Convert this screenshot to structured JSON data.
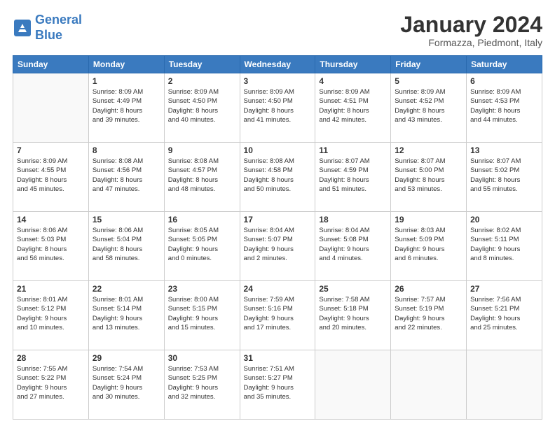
{
  "header": {
    "logo_line1": "General",
    "logo_line2": "Blue",
    "title": "January 2024",
    "subtitle": "Formazza, Piedmont, Italy"
  },
  "days_of_week": [
    "Sunday",
    "Monday",
    "Tuesday",
    "Wednesday",
    "Thursday",
    "Friday",
    "Saturday"
  ],
  "weeks": [
    [
      {
        "day": "",
        "info": ""
      },
      {
        "day": "1",
        "info": "Sunrise: 8:09 AM\nSunset: 4:49 PM\nDaylight: 8 hours\nand 39 minutes."
      },
      {
        "day": "2",
        "info": "Sunrise: 8:09 AM\nSunset: 4:50 PM\nDaylight: 8 hours\nand 40 minutes."
      },
      {
        "day": "3",
        "info": "Sunrise: 8:09 AM\nSunset: 4:50 PM\nDaylight: 8 hours\nand 41 minutes."
      },
      {
        "day": "4",
        "info": "Sunrise: 8:09 AM\nSunset: 4:51 PM\nDaylight: 8 hours\nand 42 minutes."
      },
      {
        "day": "5",
        "info": "Sunrise: 8:09 AM\nSunset: 4:52 PM\nDaylight: 8 hours\nand 43 minutes."
      },
      {
        "day": "6",
        "info": "Sunrise: 8:09 AM\nSunset: 4:53 PM\nDaylight: 8 hours\nand 44 minutes."
      }
    ],
    [
      {
        "day": "7",
        "info": "Sunrise: 8:09 AM\nSunset: 4:55 PM\nDaylight: 8 hours\nand 45 minutes."
      },
      {
        "day": "8",
        "info": "Sunrise: 8:08 AM\nSunset: 4:56 PM\nDaylight: 8 hours\nand 47 minutes."
      },
      {
        "day": "9",
        "info": "Sunrise: 8:08 AM\nSunset: 4:57 PM\nDaylight: 8 hours\nand 48 minutes."
      },
      {
        "day": "10",
        "info": "Sunrise: 8:08 AM\nSunset: 4:58 PM\nDaylight: 8 hours\nand 50 minutes."
      },
      {
        "day": "11",
        "info": "Sunrise: 8:07 AM\nSunset: 4:59 PM\nDaylight: 8 hours\nand 51 minutes."
      },
      {
        "day": "12",
        "info": "Sunrise: 8:07 AM\nSunset: 5:00 PM\nDaylight: 8 hours\nand 53 minutes."
      },
      {
        "day": "13",
        "info": "Sunrise: 8:07 AM\nSunset: 5:02 PM\nDaylight: 8 hours\nand 55 minutes."
      }
    ],
    [
      {
        "day": "14",
        "info": "Sunrise: 8:06 AM\nSunset: 5:03 PM\nDaylight: 8 hours\nand 56 minutes."
      },
      {
        "day": "15",
        "info": "Sunrise: 8:06 AM\nSunset: 5:04 PM\nDaylight: 8 hours\nand 58 minutes."
      },
      {
        "day": "16",
        "info": "Sunrise: 8:05 AM\nSunset: 5:05 PM\nDaylight: 9 hours\nand 0 minutes."
      },
      {
        "day": "17",
        "info": "Sunrise: 8:04 AM\nSunset: 5:07 PM\nDaylight: 9 hours\nand 2 minutes."
      },
      {
        "day": "18",
        "info": "Sunrise: 8:04 AM\nSunset: 5:08 PM\nDaylight: 9 hours\nand 4 minutes."
      },
      {
        "day": "19",
        "info": "Sunrise: 8:03 AM\nSunset: 5:09 PM\nDaylight: 9 hours\nand 6 minutes."
      },
      {
        "day": "20",
        "info": "Sunrise: 8:02 AM\nSunset: 5:11 PM\nDaylight: 9 hours\nand 8 minutes."
      }
    ],
    [
      {
        "day": "21",
        "info": "Sunrise: 8:01 AM\nSunset: 5:12 PM\nDaylight: 9 hours\nand 10 minutes."
      },
      {
        "day": "22",
        "info": "Sunrise: 8:01 AM\nSunset: 5:14 PM\nDaylight: 9 hours\nand 13 minutes."
      },
      {
        "day": "23",
        "info": "Sunrise: 8:00 AM\nSunset: 5:15 PM\nDaylight: 9 hours\nand 15 minutes."
      },
      {
        "day": "24",
        "info": "Sunrise: 7:59 AM\nSunset: 5:16 PM\nDaylight: 9 hours\nand 17 minutes."
      },
      {
        "day": "25",
        "info": "Sunrise: 7:58 AM\nSunset: 5:18 PM\nDaylight: 9 hours\nand 20 minutes."
      },
      {
        "day": "26",
        "info": "Sunrise: 7:57 AM\nSunset: 5:19 PM\nDaylight: 9 hours\nand 22 minutes."
      },
      {
        "day": "27",
        "info": "Sunrise: 7:56 AM\nSunset: 5:21 PM\nDaylight: 9 hours\nand 25 minutes."
      }
    ],
    [
      {
        "day": "28",
        "info": "Sunrise: 7:55 AM\nSunset: 5:22 PM\nDaylight: 9 hours\nand 27 minutes."
      },
      {
        "day": "29",
        "info": "Sunrise: 7:54 AM\nSunset: 5:24 PM\nDaylight: 9 hours\nand 30 minutes."
      },
      {
        "day": "30",
        "info": "Sunrise: 7:53 AM\nSunset: 5:25 PM\nDaylight: 9 hours\nand 32 minutes."
      },
      {
        "day": "31",
        "info": "Sunrise: 7:51 AM\nSunset: 5:27 PM\nDaylight: 9 hours\nand 35 minutes."
      },
      {
        "day": "",
        "info": ""
      },
      {
        "day": "",
        "info": ""
      },
      {
        "day": "",
        "info": ""
      }
    ]
  ]
}
